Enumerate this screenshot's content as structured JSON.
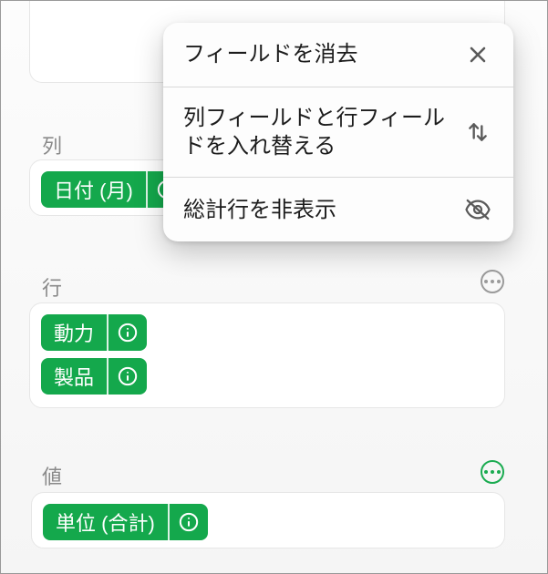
{
  "sections": {
    "columns": {
      "label": "列"
    },
    "rows": {
      "label": "行"
    },
    "values": {
      "label": "値"
    }
  },
  "chips": {
    "columns": [
      {
        "label": "日付 (月)"
      }
    ],
    "rows": [
      {
        "label": "動力"
      },
      {
        "label": "製品"
      }
    ],
    "values": [
      {
        "label": "単位 (合計)"
      }
    ]
  },
  "popover": {
    "items": [
      {
        "label": "フィールドを消去",
        "icon": "close-icon"
      },
      {
        "label": "列フィールドと行フィールドを入れ替える",
        "icon": "swap-icon"
      },
      {
        "label": "総計行を非表示",
        "icon": "eye-off-icon"
      }
    ]
  },
  "icons": {
    "info": "info-icon",
    "more": "more-icon"
  }
}
